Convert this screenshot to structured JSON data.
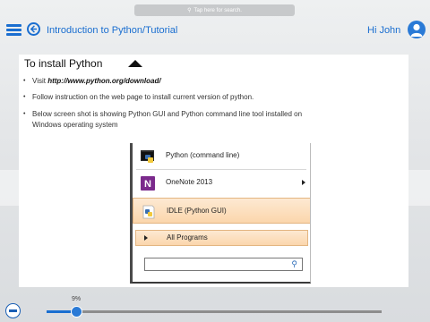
{
  "search": {
    "placeholder": "Tap here for search."
  },
  "header": {
    "breadcrumb": "Introduction to Python/Tutorial",
    "greeting": "Hi John"
  },
  "content": {
    "title": "To install Python",
    "bullets": [
      {
        "prefix": "Visit ",
        "link": "http://www.python.org/download/"
      },
      {
        "text": "Follow instruction on the web page to install current version of python."
      },
      {
        "line1": "Below screen shot is showing Python GUI and Python command line tool installed on",
        "line2": "Windows operating system"
      }
    ]
  },
  "screenshot": {
    "items": [
      {
        "label": "Python (command line)",
        "icon": "python-icon"
      },
      {
        "label": "OneNote 2013",
        "icon": "onenote-icon"
      },
      {
        "label": "IDLE (Python GUI)",
        "icon": "python-idle-icon"
      }
    ],
    "all_programs": "All Programs"
  },
  "progress": {
    "percent_label": "9%",
    "value": 0.09
  },
  "colors": {
    "accent": "#1a6ed0",
    "highlight": "#fbd6ac",
    "onenote": "#7b2a8c"
  }
}
